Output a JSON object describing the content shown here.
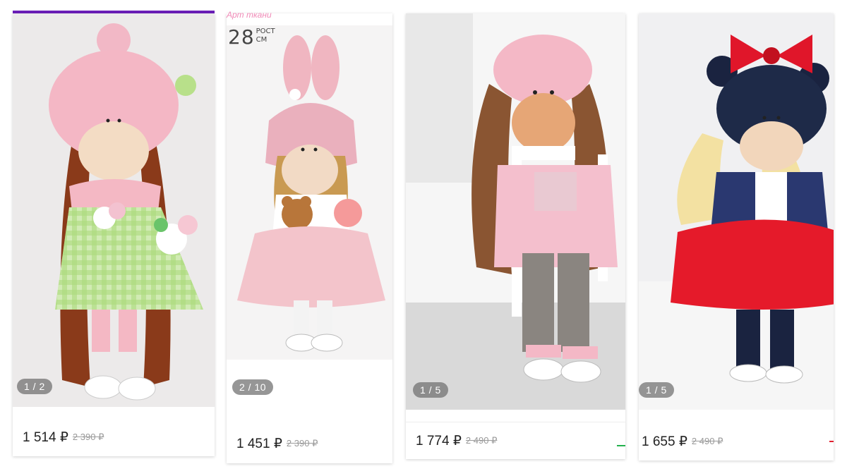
{
  "brand_caption": "Арт ткани",
  "height_badge": {
    "value": "28",
    "unit_top": "РОСТ",
    "unit_bottom": "СМ"
  },
  "cards": [
    {
      "counter": "1 / 2",
      "price": "1 514 ₽",
      "old_price": "2 390 ₽"
    },
    {
      "counter": "2 / 10",
      "price": "1 451 ₽",
      "old_price": "2 390 ₽"
    },
    {
      "counter": "1 / 5",
      "price": "1 774 ₽",
      "old_price": "2 490 ₽",
      "accent_color": "#22b14c"
    },
    {
      "counter": "1 / 5",
      "price": "1 655 ₽",
      "old_price": "2 490 ₽",
      "accent_color": "#e02030"
    }
  ],
  "colors": {
    "topbar": "#6a1fb8",
    "brand": "#f08ab7"
  }
}
